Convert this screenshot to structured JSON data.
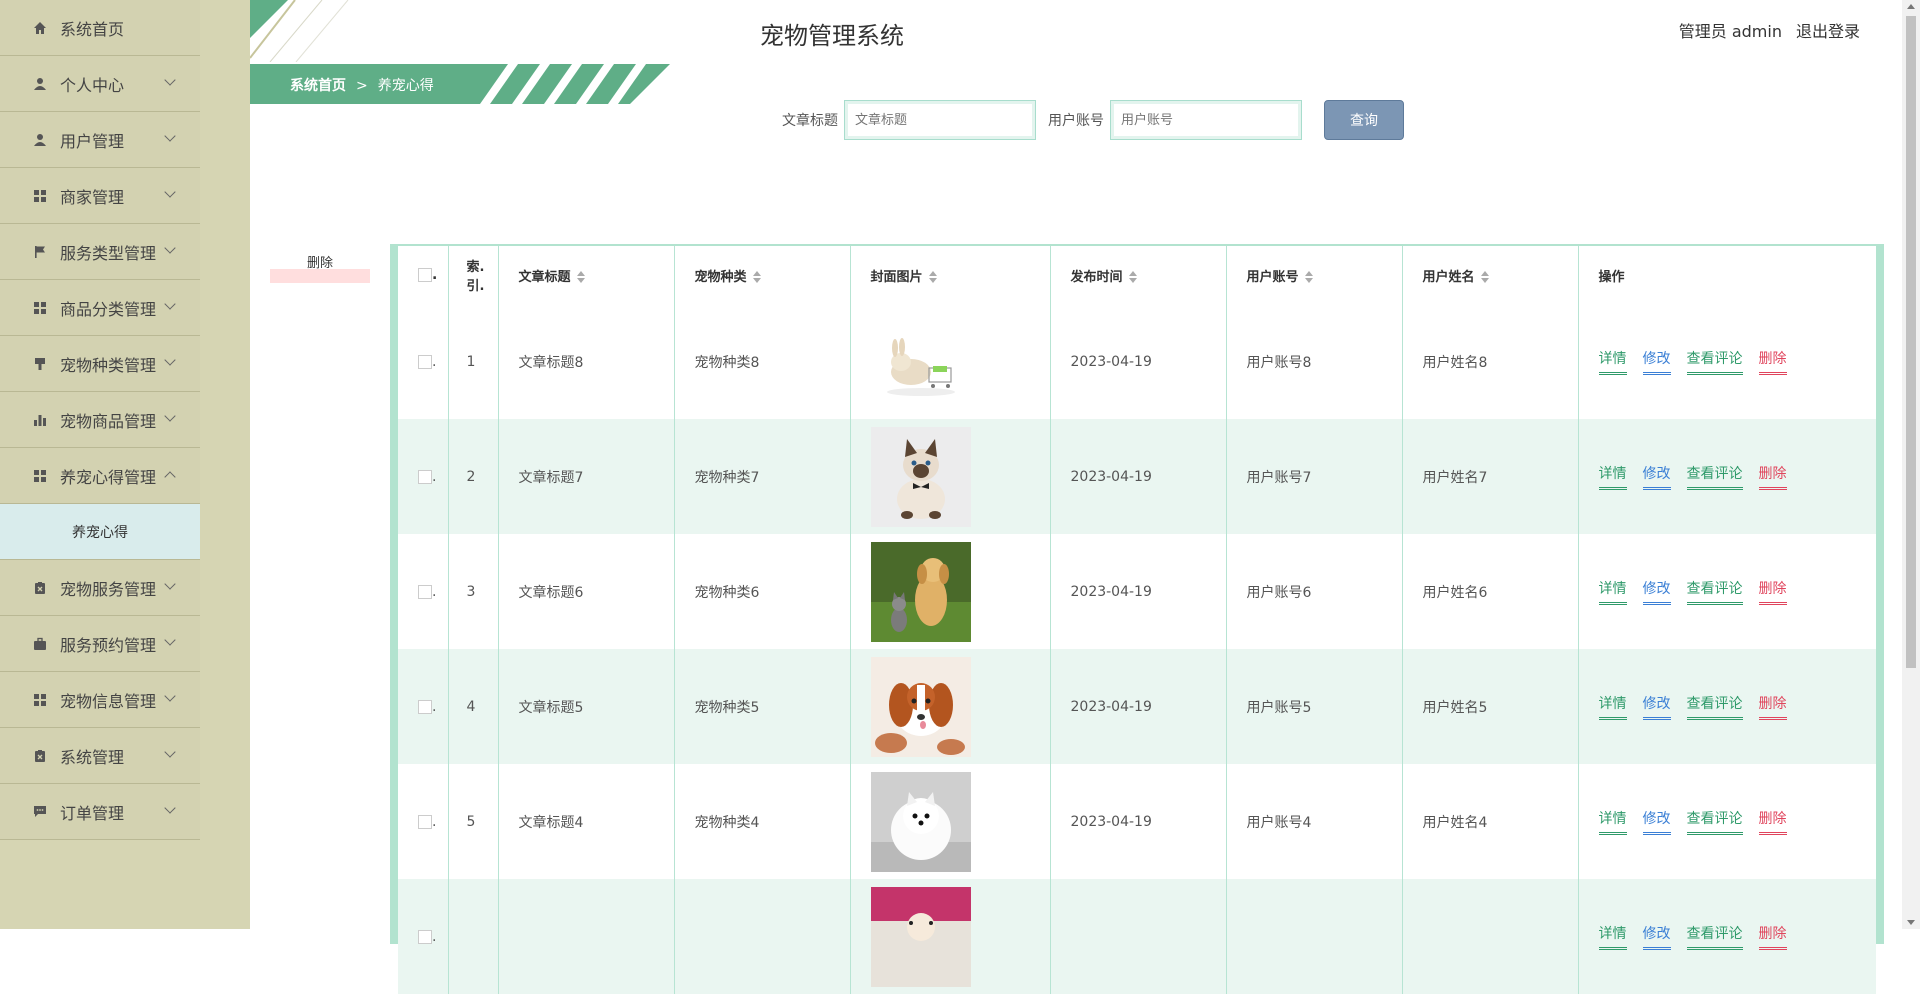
{
  "header": {
    "title": "宠物管理系统",
    "user": "管理员 admin",
    "logout": "退出登录"
  },
  "breadcrumb": {
    "home": "系统首页",
    "separator": ">",
    "current": "养宠心得"
  },
  "sidebar": {
    "items": [
      {
        "label": "系统首页",
        "icon": "home-icon"
      },
      {
        "label": "个人中心",
        "icon": "user-icon"
      },
      {
        "label": "用户管理",
        "icon": "user-icon"
      },
      {
        "label": "商家管理",
        "icon": "grid-icon"
      },
      {
        "label": "服务类型管理",
        "icon": "flag-icon"
      },
      {
        "label": "商品分类管理",
        "icon": "grid-icon"
      },
      {
        "label": "宠物种类管理",
        "icon": "brush-icon"
      },
      {
        "label": "宠物商品管理",
        "icon": "bar-chart-icon"
      },
      {
        "label": "养宠心得管理",
        "icon": "grid-icon",
        "expanded": true
      },
      {
        "label": "宠物服务管理",
        "icon": "clipboard-icon"
      },
      {
        "label": "服务预约管理",
        "icon": "briefcase-icon"
      },
      {
        "label": "宠物信息管理",
        "icon": "grid-icon"
      },
      {
        "label": "系统管理",
        "icon": "clipboard-icon"
      },
      {
        "label": "订单管理",
        "icon": "chat-icon"
      }
    ],
    "submenu": {
      "label": "养宠心得"
    }
  },
  "search": {
    "title_label": "文章标题",
    "title_placeholder": "文章标题",
    "account_label": "用户账号",
    "account_placeholder": "用户账号",
    "button": "查询"
  },
  "bulk_delete": "删除",
  "table": {
    "headers": {
      "index": "索.引.",
      "title": "文章标题",
      "species": "宠物种类",
      "cover": "封面图片",
      "time": "发布时间",
      "account": "用户账号",
      "name": "用户姓名",
      "ops": "操作"
    },
    "ops": {
      "detail": "详情",
      "edit": "修改",
      "comments": "查看评论",
      "delete": "删除"
    },
    "rows": [
      {
        "index": "1",
        "title": "文章标题8",
        "species": "宠物种类8",
        "time": "2023-04-19",
        "account": "用户账号8",
        "name": "用户姓名8",
        "image": "bunny"
      },
      {
        "index": "2",
        "title": "文章标题7",
        "species": "宠物种类7",
        "time": "2023-04-19",
        "account": "用户账号7",
        "name": "用户姓名7",
        "image": "siamese-cat"
      },
      {
        "index": "3",
        "title": "文章标题6",
        "species": "宠物种类6",
        "time": "2023-04-19",
        "account": "用户账号6",
        "name": "用户姓名6",
        "image": "puppy-kitten"
      },
      {
        "index": "4",
        "title": "文章标题5",
        "species": "宠物种类5",
        "time": "2023-04-19",
        "account": "用户账号5",
        "name": "用户姓名5",
        "image": "spaniel-puppy"
      },
      {
        "index": "5",
        "title": "文章标题4",
        "species": "宠物种类4",
        "time": "2023-04-19",
        "account": "用户账号4",
        "name": "用户姓名4",
        "image": "pomeranian"
      },
      {
        "index": "",
        "title": "",
        "species": "",
        "time": "",
        "account": "",
        "name": "",
        "image": "poodle"
      }
    ]
  },
  "colors": {
    "accent": "#5fae87",
    "sidebar": "#d3d2b1",
    "row_alt": "#eaf6f1",
    "delete": "#e0445c",
    "edit": "#3a7fd5"
  }
}
